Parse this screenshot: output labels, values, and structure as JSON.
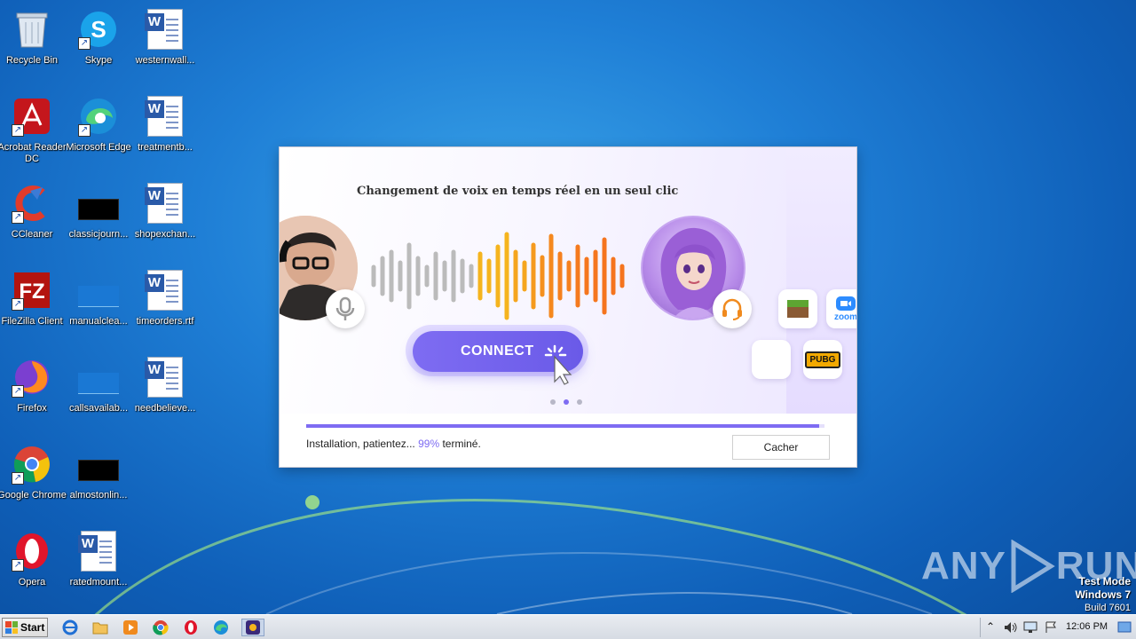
{
  "desktop": {
    "icons": [
      {
        "label": "Recycle Bin"
      },
      {
        "label": "Skype"
      },
      {
        "label": "westernwall..."
      },
      {
        "label": "Acrobat Reader DC"
      },
      {
        "label": "Microsoft Edge"
      },
      {
        "label": "treatmentb..."
      },
      {
        "label": "CCleaner"
      },
      {
        "label": "classicjourn..."
      },
      {
        "label": "shopexchan..."
      },
      {
        "label": "FileZilla Client"
      },
      {
        "label": "manualclea..."
      },
      {
        "label": "timeorders.rtf"
      },
      {
        "label": "Firefox"
      },
      {
        "label": "callsavailab..."
      },
      {
        "label": "needbelieve..."
      },
      {
        "label": "Google Chrome"
      },
      {
        "label": "almostonlin..."
      },
      {
        "label": "Opera"
      },
      {
        "label": "ratedmount..."
      }
    ]
  },
  "installer": {
    "tagline": "Changement de voix en temps réel en un seul clic",
    "connect_label": "CONNECT",
    "app_tiles": {
      "zoom": "zoom",
      "pubg": "PUBG"
    },
    "carousel": {
      "count": 3,
      "active_index": 1
    },
    "progress": {
      "percent": 99
    },
    "status_prefix": "Installation, patientez...",
    "status_percent": "99%",
    "status_suffix": "terminé.",
    "hide_button": "Cacher"
  },
  "watermark": {
    "text_left": "ANY",
    "text_right": "RUN"
  },
  "testmode": {
    "line1": "Test Mode",
    "line2": "Windows 7",
    "line3": "Build 7601"
  },
  "taskbar": {
    "start_label": "Start",
    "clock": "12:06 PM",
    "pinned": [
      "internet-explorer-icon",
      "explorer-folder-icon",
      "media-player-icon",
      "chrome-icon",
      "opera-icon",
      "edge-icon",
      "installer-app-icon"
    ]
  },
  "colors": {
    "accent": "#7e6cf2",
    "desktop": "#1f7fd6"
  }
}
